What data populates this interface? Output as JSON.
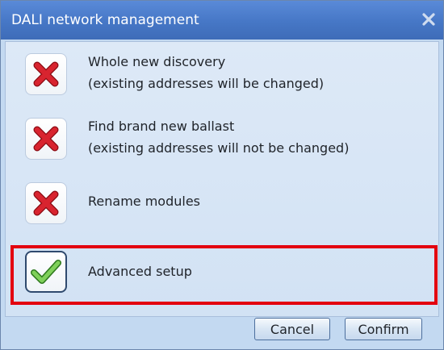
{
  "dialog": {
    "title": "DALI network management",
    "options": [
      {
        "line1": "Whole new discovery",
        "line2": "(existing addresses will be changed)",
        "state": "disabled"
      },
      {
        "line1": "Find brand new ballast",
        "line2": "(existing addresses will not be changed)",
        "state": "disabled"
      },
      {
        "line1": "Rename modules",
        "line2": "",
        "state": "disabled"
      },
      {
        "line1": "Advanced setup",
        "line2": "",
        "state": "selected"
      }
    ],
    "buttons": {
      "cancel": "Cancel",
      "confirm": "Confirm"
    }
  },
  "icons": {
    "disabled": "red-x-icon",
    "selected": "green-check-icon",
    "close": "close-icon"
  },
  "colors": {
    "highlight": "#e3000f",
    "titlebar": "#4677c6"
  }
}
